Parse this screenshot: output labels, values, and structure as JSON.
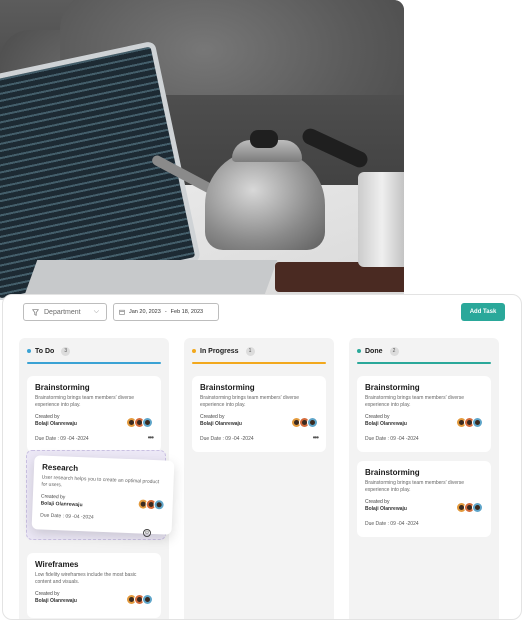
{
  "toolbar": {
    "department_label": "Department",
    "date_start": "Jan 20, 2023",
    "date_separator": "-",
    "date_end": "Feb 18, 2023",
    "add_task_label": "Add Task"
  },
  "colors": {
    "accent": "#2aa89a",
    "todo": "#3aa2d4",
    "in_progress": "#f2a81d",
    "done": "#2aa89a"
  },
  "columns": [
    {
      "title": "To Do",
      "count": "3",
      "cards": [
        {
          "title": "Brainstorming",
          "desc": "Brainstorming brings team members' diverse experience into play.",
          "created_label": "Created by",
          "creator": "Bolaji Olanrewaju",
          "due": "Due Date : 09 -04 -2024"
        },
        {
          "title": "Wireframes",
          "desc": "Low fidelity wireframes include the most basic content and visuals.",
          "created_label": "Created by",
          "creator": "Bolaji Olanrewaju"
        }
      ]
    },
    {
      "title": "In Progress",
      "count": "1",
      "cards": [
        {
          "title": "Brainstorming",
          "desc": "Brainstorming brings team members' diverse experience into play.",
          "created_label": "Created by",
          "creator": "Bolaji Olanrewaju",
          "due": "Due Date : 09 -04 -2024"
        }
      ]
    },
    {
      "title": "Done",
      "count": "2",
      "cards": [
        {
          "title": "Brainstorming",
          "desc": "Brainstorming brings team members' diverse experience into play.",
          "created_label": "Created by",
          "creator": "Bolaji Olanrewaju",
          "due": "Due Date : 09 -04 -2024"
        },
        {
          "title": "Brainstorming",
          "desc": "Brainstorming brings team members' diverse experience into play.",
          "created_label": "Created by",
          "creator": "Bolaji Olanrewaju",
          "due": "Due Date : 09 -04 -2024"
        }
      ]
    }
  ],
  "dragging_card": {
    "title": "Research",
    "desc": "User research helps you to create an optimal product for users.",
    "created_label": "Created by",
    "creator": "Bolaji Olanrewaju",
    "due": "Due Date : 09 -04 -2024"
  },
  "icons": {
    "filter": "filter-icon",
    "chevron": "chevron-down-icon",
    "calendar": "calendar-icon",
    "more": "more-icon",
    "drag": "drag-handle-icon"
  }
}
